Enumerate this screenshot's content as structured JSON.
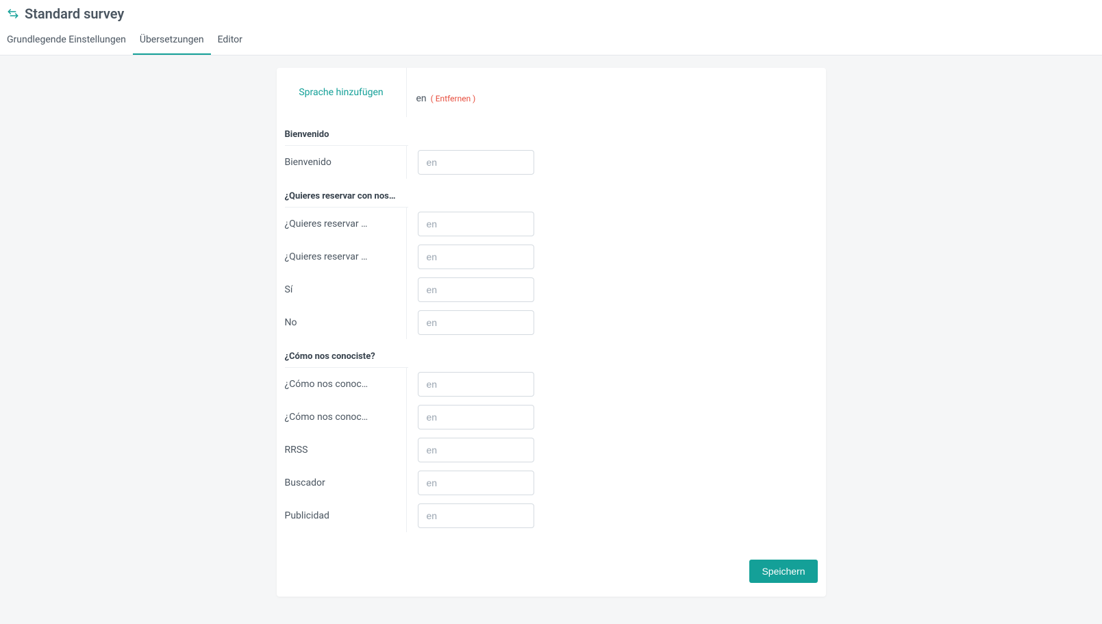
{
  "header": {
    "title": "Standard survey",
    "tabs": [
      {
        "label": "Grundlegende Einstellungen",
        "active": false
      },
      {
        "label": "Übersetzungen",
        "active": true
      },
      {
        "label": "Editor",
        "active": false
      }
    ]
  },
  "panel": {
    "add_language_label": "Sprache hinzufügen",
    "language_code": "en",
    "remove_label": "( Entfernen )",
    "input_placeholder": "en",
    "save_label": "Speichern"
  },
  "sections": [
    {
      "title": "Bienvenido",
      "rows": [
        {
          "label": "Bienvenido"
        }
      ]
    },
    {
      "title": "¿Quieres reservar con nos…",
      "rows": [
        {
          "label": "¿Quieres reservar …"
        },
        {
          "label": "¿Quieres reservar …"
        },
        {
          "label": "Sí"
        },
        {
          "label": "No"
        }
      ]
    },
    {
      "title": "¿Cómo nos conociste?",
      "rows": [
        {
          "label": "¿Cómo nos conoc…"
        },
        {
          "label": "¿Cómo nos conoc…"
        },
        {
          "label": "RRSS"
        },
        {
          "label": "Buscador"
        },
        {
          "label": "Publicidad"
        }
      ]
    }
  ]
}
